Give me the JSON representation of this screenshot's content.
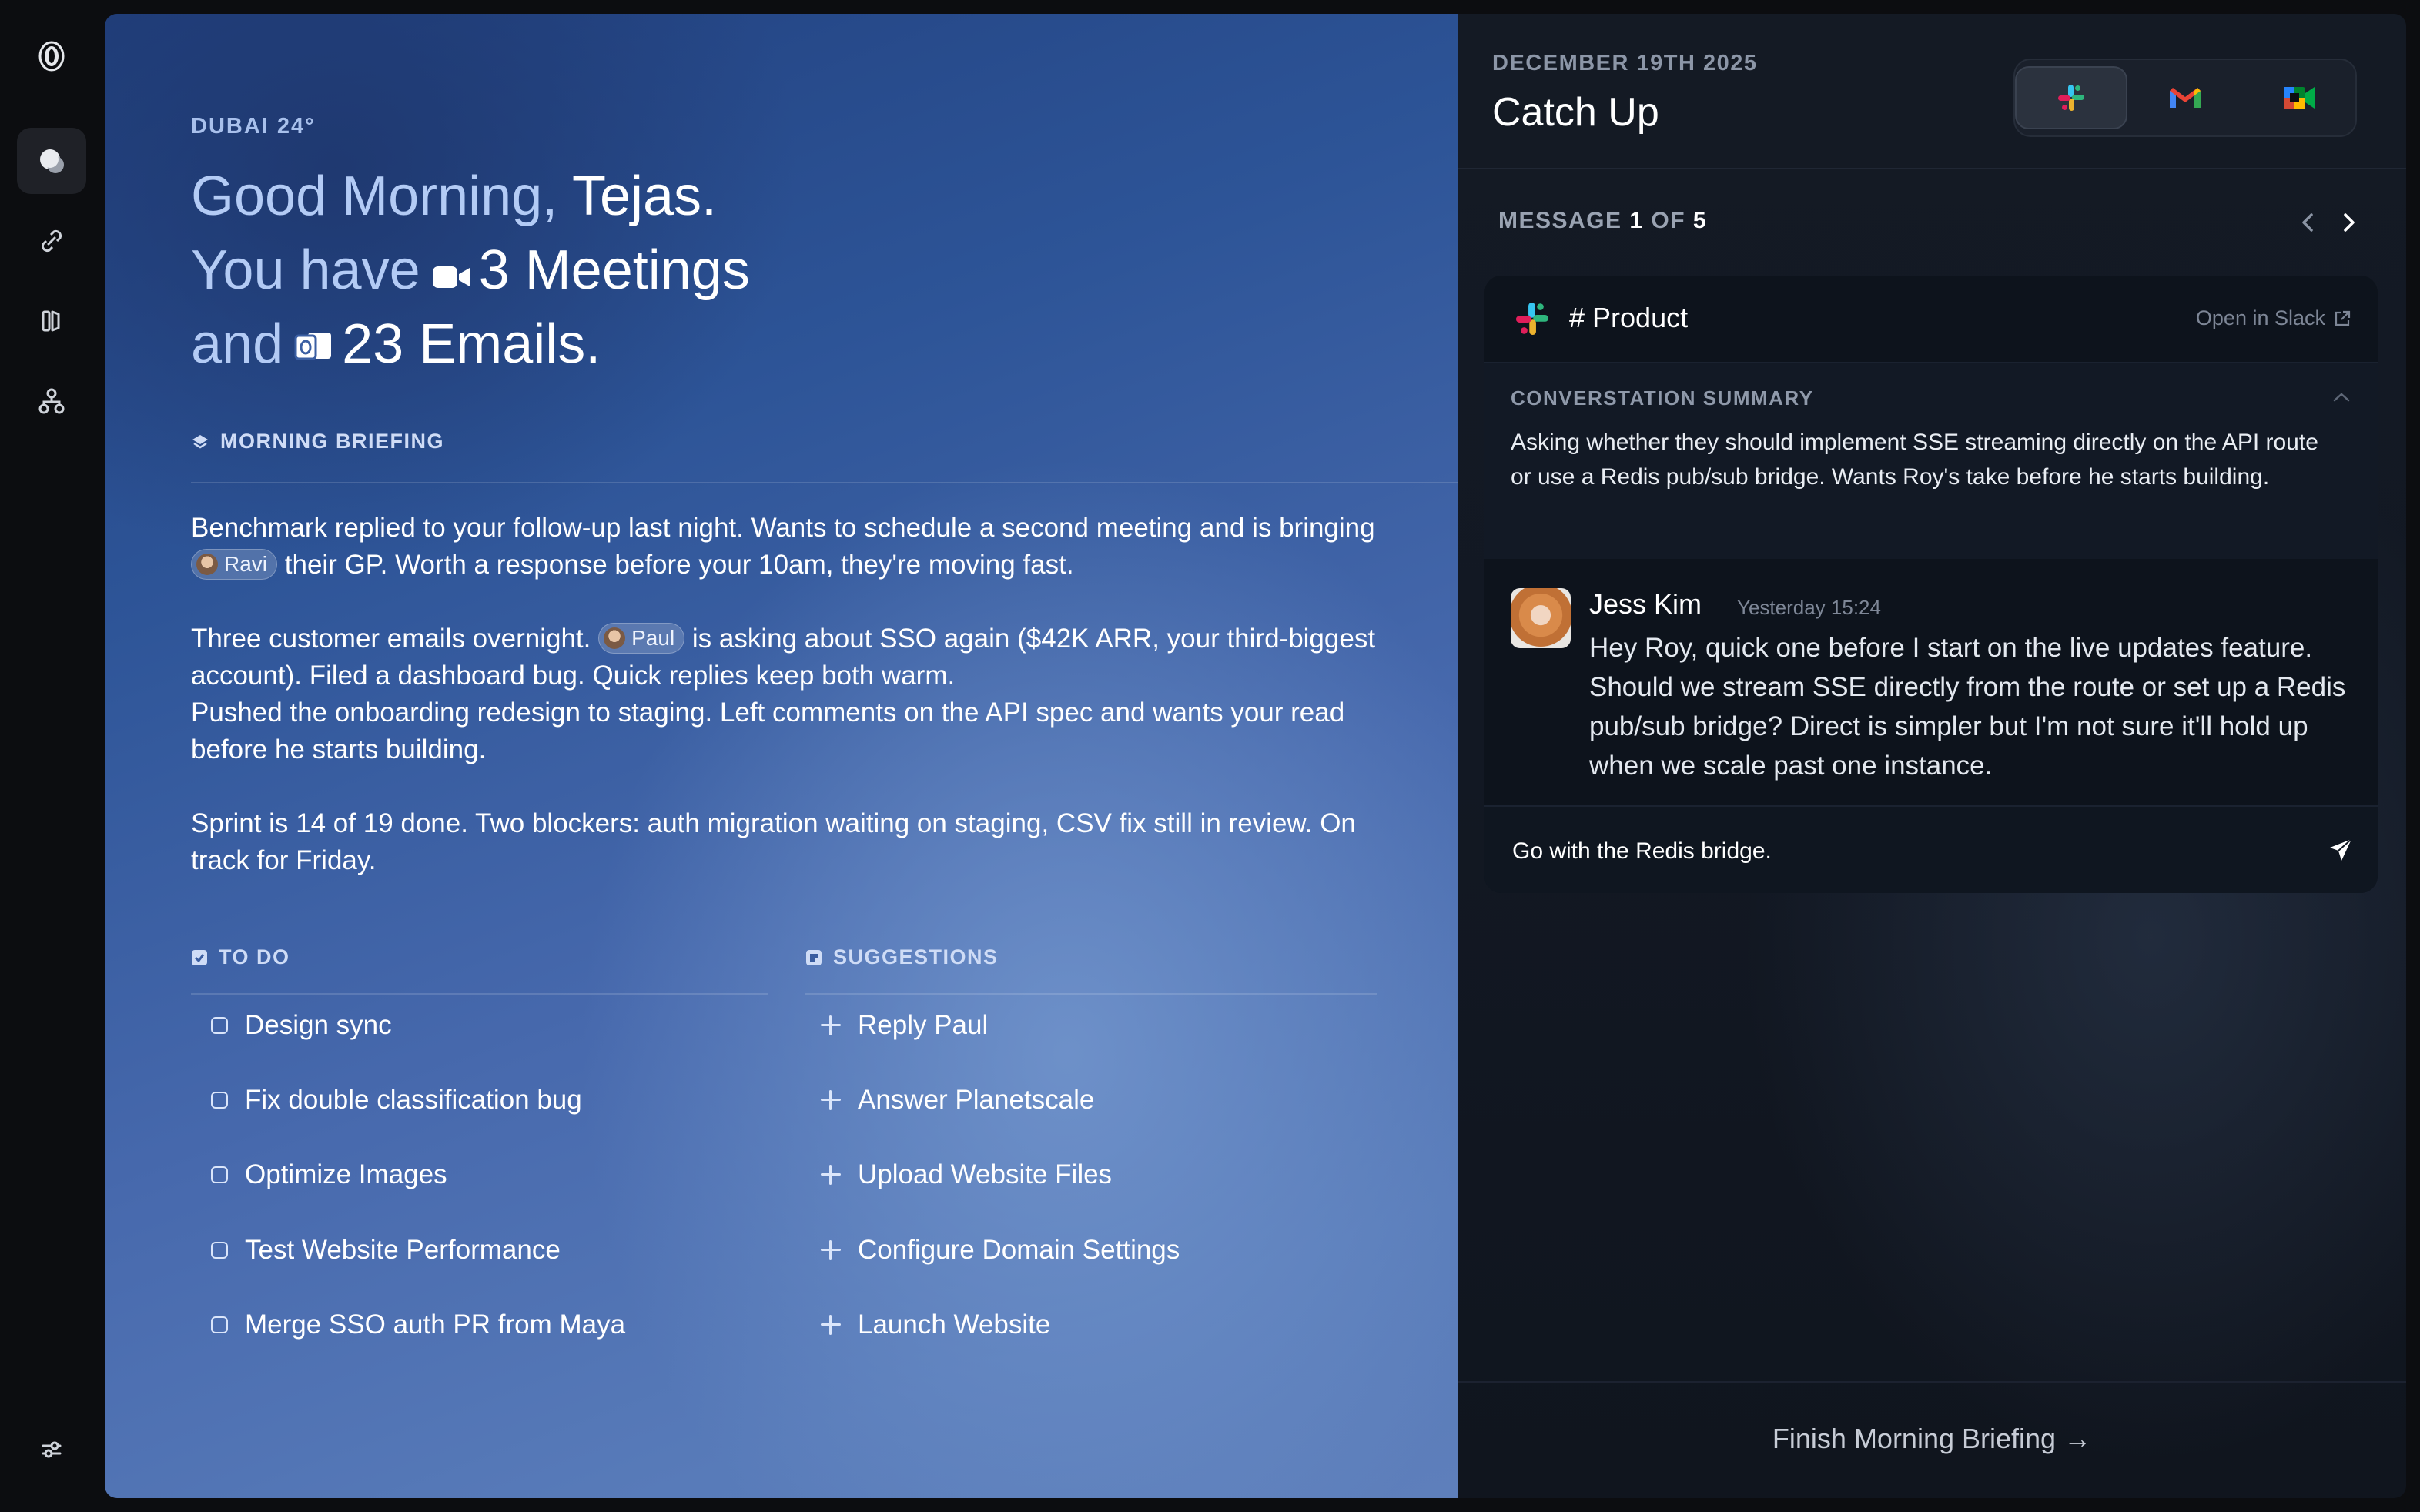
{
  "colors": {
    "accent": "#b3cbf5",
    "panel": "#141a24",
    "card": "#0d131c"
  },
  "sidebar": {
    "icons": [
      "logo-icon",
      "chat-icon",
      "link-icon",
      "briefing-icon",
      "org-chart-icon",
      "settings-sliders-icon"
    ]
  },
  "briefing": {
    "location": "DUBAI 24°",
    "greeting_prefix": "Good Morning, ",
    "name": "Tejas.",
    "you_have": "You have",
    "meetings": "3 Meetings",
    "and": "and",
    "emails": "23 Emails.",
    "section_label": "MORNING BRIEFING",
    "p1_a": "Benchmark replied to your follow-up last night. Wants to schedule a second meeting and is bringing",
    "p1_chip": "Ravi",
    "p1_b": "their GP. Worth a response before your 10am, they're moving fast.",
    "p2_a": "Three customer emails overnight.",
    "p2_chip": "Paul",
    "p2_b": "is asking about SSO again ($42K ARR, your third-biggest account). Filed a dashboard bug. Quick replies keep both warm.",
    "p3": "Pushed the onboarding redesign to staging. Left comments on the API spec and wants your read before he starts building.",
    "p4": "Sprint is 14 of 19 done. Two blockers: auth migration waiting on staging, CSV fix still in review. On track for Friday."
  },
  "todo": {
    "label": "TO DO",
    "items": [
      "Design sync",
      "Fix double classification bug",
      "Optimize Images",
      "Test Website Performance",
      "Merge SSO auth PR from Maya"
    ]
  },
  "suggestions": {
    "label": "SUGGESTIONS",
    "items": [
      "Reply Paul",
      "Answer Planetscale",
      "Upload Website Files",
      "Configure Domain Settings",
      "Launch Website"
    ]
  },
  "catchup": {
    "date": "DECEMBER 19TH 2025",
    "title": "Catch Up",
    "apps": [
      "slack-icon",
      "gmail-icon",
      "meet-icon"
    ],
    "message_label": "MESSAGE",
    "current": "1",
    "of": "OF",
    "total": "5",
    "channel": "# Product",
    "open_in": "Open in Slack",
    "summary_label": "CONVERSTATION SUMMARY",
    "summary": "Asking whether they should implement SSE streaming directly on the API route or use a Redis pub/sub bridge. Wants Roy's take before he starts building.",
    "author": "Jess Kim",
    "timestamp": "Yesterday 15:24",
    "message": "Hey Roy, quick one before I start on the live updates feature. Should we stream SSE directly from the route or set up a Redis pub/sub bridge? Direct is simpler but I'm not sure it'll hold up when we scale past one instance.",
    "reply_value": "Go with the Redis bridge.",
    "finish": "Finish Morning Briefing →"
  }
}
